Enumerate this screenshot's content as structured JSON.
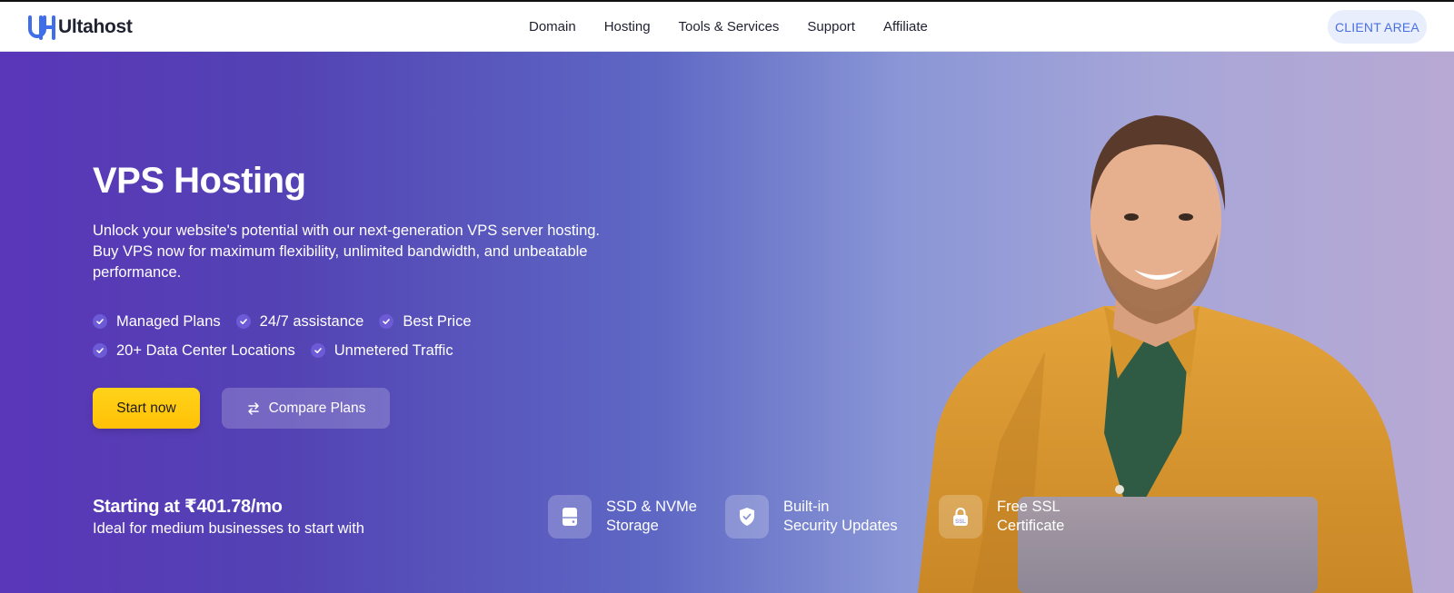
{
  "header": {
    "logo_text": "Ultahost",
    "nav": [
      "Domain",
      "Hosting",
      "Tools & Services",
      "Support",
      "Affiliate"
    ],
    "client_area": "CLIENT AREA"
  },
  "hero": {
    "title": "VPS Hosting",
    "description": "Unlock your website's potential with our next-generation VPS server hosting. Buy VPS now for maximum flexibility, unlimited bandwidth, and unbeatable performance.",
    "features_row1": [
      "Managed Plans",
      "24/7 assistance",
      "Best Price"
    ],
    "features_row2": [
      "20+ Data Center Locations",
      "Unmetered Traffic"
    ],
    "start_button": "Start now",
    "compare_button": "Compare Plans",
    "price": "Starting at ₹401.78/mo",
    "price_subtitle": "Ideal for medium businesses to start with",
    "badges": [
      {
        "line1": "SSD & NVMe",
        "line2": "Storage",
        "icon": "storage-icon"
      },
      {
        "line1": "Built-in",
        "line2": "Security Updates",
        "icon": "shield-check-icon"
      },
      {
        "line1": "Free SSL",
        "line2": "Certificate",
        "icon": "ssl-lock-icon"
      }
    ]
  },
  "colors": {
    "brand_blue": "#3f6ee8",
    "hero_start": "#5a36b8",
    "hero_end": "#b8a9d4",
    "cta_yellow": "#ffc107",
    "client_area_text": "#4a6fe0"
  }
}
